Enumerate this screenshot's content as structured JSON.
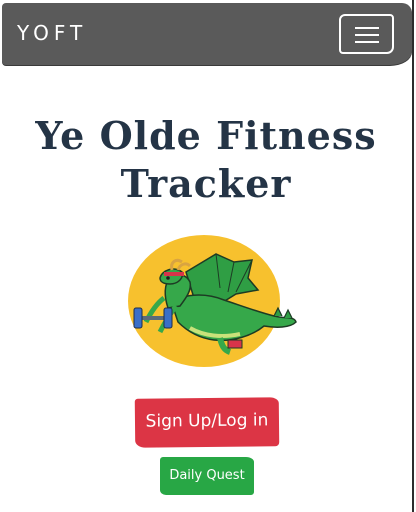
{
  "navbar": {
    "brand": "YOFT",
    "toggle_icon": "hamburger-menu-icon"
  },
  "hero": {
    "title": "Ye Olde Fitness Tracker",
    "mascot_icon": "dragon-lifting-weights-icon"
  },
  "actions": {
    "signup_label": "Sign Up/Log in",
    "daily_quest_label": "Daily Quest"
  },
  "colors": {
    "navbar_bg": "#5a5a5a",
    "title_text": "#243446",
    "signup_button": "#dc3545",
    "daily_quest_button": "#28a745",
    "mascot_circle": "#f7c12e",
    "dragon": "#2f9e44"
  }
}
